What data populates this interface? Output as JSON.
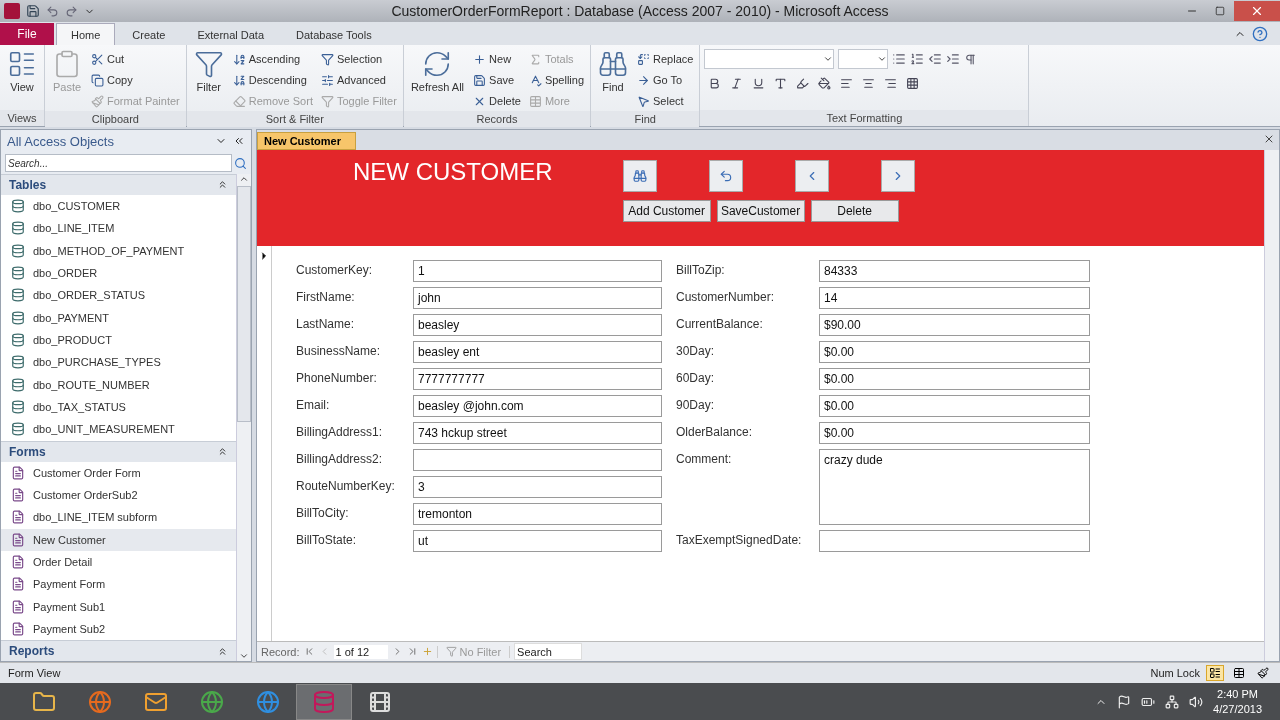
{
  "window": {
    "title": "CustomerOrderFormReport : Database (Access 2007 - 2010) - Microsoft Access"
  },
  "ribbon": {
    "file_tab": "File",
    "tabs": [
      {
        "label": "Home",
        "selected": true
      },
      {
        "label": "Create",
        "selected": false
      },
      {
        "label": "External Data",
        "selected": false
      },
      {
        "label": "Database Tools",
        "selected": false
      }
    ],
    "groups": [
      {
        "label": "Views",
        "commands": [
          {
            "label": "View",
            "kind": "large",
            "disabled": false
          }
        ]
      },
      {
        "label": "Clipboard",
        "commands": [
          {
            "label": "Paste",
            "kind": "large",
            "disabled": true
          },
          {
            "label": "Cut",
            "kind": "small",
            "disabled": false
          },
          {
            "label": "Copy",
            "kind": "small",
            "disabled": false
          },
          {
            "label": "Format Painter",
            "kind": "small",
            "disabled": true
          }
        ]
      },
      {
        "label": "Sort & Filter",
        "commands": [
          {
            "label": "Filter",
            "kind": "large",
            "disabled": false
          },
          {
            "label": "Ascending",
            "kind": "small",
            "disabled": false
          },
          {
            "label": "Descending",
            "kind": "small",
            "disabled": false
          },
          {
            "label": "Remove Sort",
            "kind": "small",
            "disabled": true
          },
          {
            "label": "Selection",
            "kind": "small",
            "disabled": false
          },
          {
            "label": "Advanced",
            "kind": "small",
            "disabled": false
          },
          {
            "label": "Toggle Filter",
            "kind": "small",
            "disabled": true
          }
        ]
      },
      {
        "label": "Records",
        "commands": [
          {
            "label": "Refresh All",
            "kind": "large",
            "disabled": false
          },
          {
            "label": "New",
            "kind": "small",
            "disabled": false
          },
          {
            "label": "Save",
            "kind": "small",
            "disabled": false
          },
          {
            "label": "Delete",
            "kind": "small",
            "disabled": false
          },
          {
            "label": "Totals",
            "kind": "small",
            "disabled": true
          },
          {
            "label": "Spelling",
            "kind": "small",
            "disabled": false
          },
          {
            "label": "More",
            "kind": "small",
            "disabled": true
          }
        ]
      },
      {
        "label": "Find",
        "commands": [
          {
            "label": "Find",
            "kind": "large",
            "disabled": false
          },
          {
            "label": "Replace",
            "kind": "small",
            "disabled": false
          },
          {
            "label": "Go To",
            "kind": "small",
            "disabled": false
          },
          {
            "label": "Select",
            "kind": "small",
            "disabled": false
          }
        ]
      },
      {
        "label": "Text Formatting"
      }
    ]
  },
  "navigation": {
    "title": "All Access Objects",
    "search_placeholder": "Search...",
    "sections": [
      {
        "title": "Tables",
        "items": [
          {
            "label": "dbo_CUSTOMER",
            "selected": false
          },
          {
            "label": "dbo_LINE_ITEM",
            "selected": false
          },
          {
            "label": "dbo_METHOD_OF_PAYMENT",
            "selected": false
          },
          {
            "label": "dbo_ORDER",
            "selected": false
          },
          {
            "label": "dbo_ORDER_STATUS",
            "selected": false
          },
          {
            "label": "dbo_PAYMENT",
            "selected": false
          },
          {
            "label": "dbo_PRODUCT",
            "selected": false
          },
          {
            "label": "dbo_PURCHASE_TYPES",
            "selected": false
          },
          {
            "label": "dbo_ROUTE_NUMBER",
            "selected": false
          },
          {
            "label": "dbo_TAX_STATUS",
            "selected": false
          },
          {
            "label": "dbo_UNIT_MEASUREMENT",
            "selected": false
          }
        ]
      },
      {
        "title": "Forms",
        "items": [
          {
            "label": "Customer Order Form",
            "selected": false
          },
          {
            "label": "Customer OrderSub2",
            "selected": false
          },
          {
            "label": "dbo_LINE_ITEM subform",
            "selected": false
          },
          {
            "label": "New Customer",
            "selected": true
          },
          {
            "label": "Order Detail",
            "selected": false
          },
          {
            "label": "Payment Form",
            "selected": false
          },
          {
            "label": "Payment Sub1",
            "selected": false
          },
          {
            "label": "Payment Sub2",
            "selected": false
          }
        ]
      },
      {
        "title": "Reports"
      }
    ]
  },
  "document_tabs": [
    {
      "label": "New Customer",
      "selected": true
    }
  ],
  "form": {
    "title": "NEW CUSTOMER",
    "buttons": [
      "Add Customer",
      "SaveCustomer",
      "Delete"
    ],
    "left_fields": [
      {
        "label": "CustomerKey:",
        "value": "1",
        "kind": "text"
      },
      {
        "label": "FirstName:",
        "value": "john",
        "kind": "text"
      },
      {
        "label": "LastName:",
        "value": "beasley",
        "kind": "text"
      },
      {
        "label": "BusinessName:",
        "value": "beasley ent",
        "kind": "text"
      },
      {
        "label": "PhoneNumber:",
        "value": "7777777777",
        "kind": "text"
      },
      {
        "label": "Email:",
        "value": "beasley @john.com",
        "kind": "text"
      },
      {
        "label": "BillingAddress1:",
        "value": "743 hckup street",
        "kind": "text"
      },
      {
        "label": "BillingAddress2:",
        "kind": "text"
      },
      {
        "label": "RouteNumberKey:",
        "value": "3",
        "kind": "text"
      },
      {
        "label": "BillToCity:",
        "value": "tremonton",
        "kind": "text"
      },
      {
        "label": "BillToState:",
        "value": "ut",
        "kind": "text"
      }
    ],
    "right_fields": [
      {
        "label": "BillToZip:",
        "value": "84333",
        "kind": "text"
      },
      {
        "label": "CustomerNumber:",
        "value": "14",
        "kind": "text"
      },
      {
        "label": "CurrentBalance:",
        "value": "$90.00",
        "kind": "text"
      },
      {
        "label": "30Day:",
        "value": "$0.00",
        "kind": "text"
      },
      {
        "label": "60Day:",
        "value": "$0.00",
        "kind": "text"
      },
      {
        "label": "90Day:",
        "value": "$0.00",
        "kind": "text"
      },
      {
        "label": "OlderBalance:",
        "value": "$0.00",
        "kind": "text"
      },
      {
        "label": "Comment:",
        "value": "crazy dude",
        "kind": "memo"
      },
      {
        "label": "TaxExemptSignedDate:",
        "kind": "text"
      }
    ]
  },
  "record_navigation": {
    "label": "Record:",
    "position": "1 of 12",
    "filter": "No Filter",
    "search_placeholder": "Search"
  },
  "status_bar": {
    "left": "Form View",
    "num_lock": "Num Lock"
  },
  "taskbar": {
    "time": "2:40 PM",
    "date": "4/27/2013"
  }
}
